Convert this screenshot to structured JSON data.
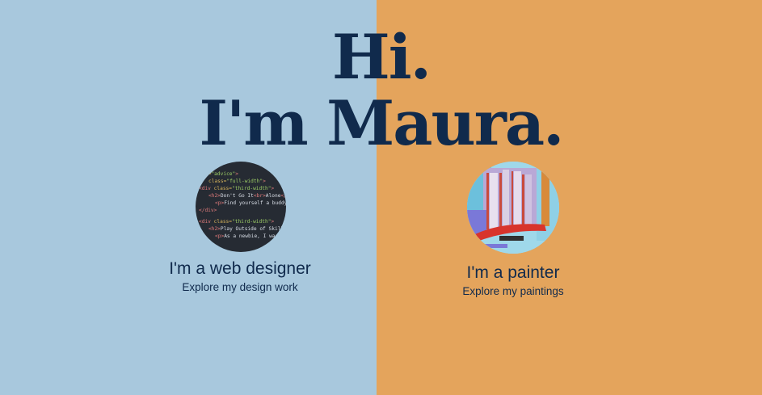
{
  "headline": {
    "line1": "Hi.",
    "line2": "I'm Maura."
  },
  "colors": {
    "left_bg": "#a8c8dd",
    "right_bg": "#e4a45c",
    "text": "#102a4c"
  },
  "web_designer": {
    "title": "I'm a web designer",
    "subtitle": "Explore my design work",
    "image": "code-snippet-thumbnail"
  },
  "painter": {
    "title": "I'm a painter",
    "subtitle": "Explore my paintings",
    "image": "abstract-painting-thumbnail"
  }
}
